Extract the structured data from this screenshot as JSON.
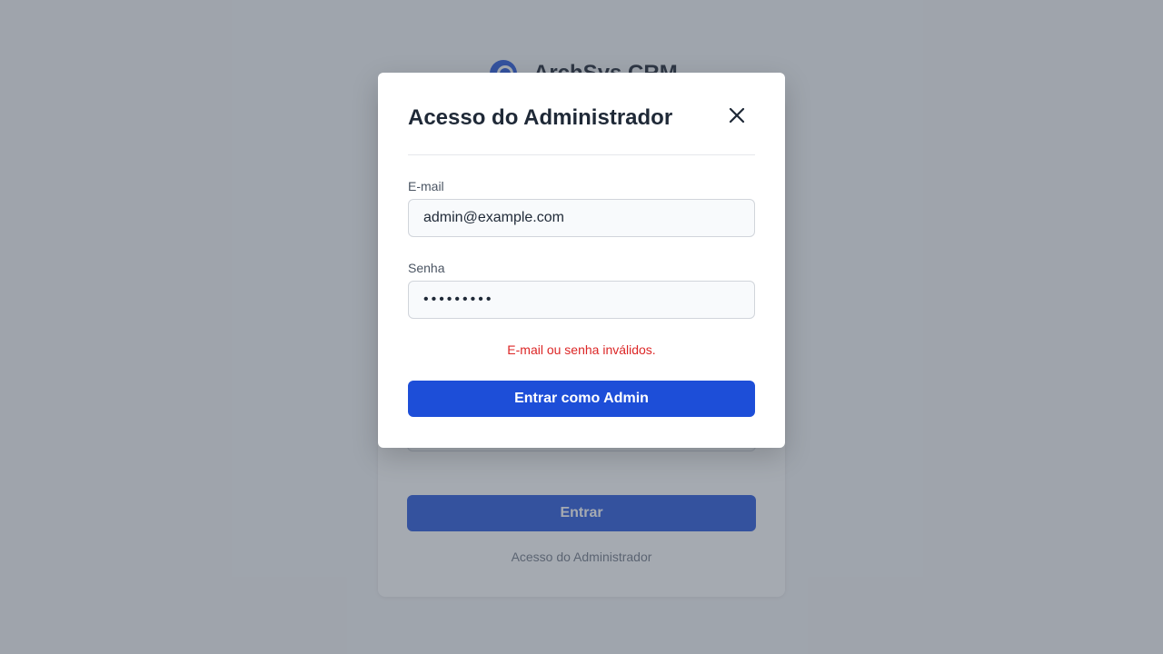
{
  "background": {
    "brand_name": "ArchSys CRM",
    "login_button_label": "Entrar",
    "admin_link_label": "Acesso do Administrador"
  },
  "modal": {
    "title": "Acesso do Administrador",
    "email_label": "E-mail",
    "email_value": "admin@example.com",
    "password_label": "Senha",
    "password_value": "•••••••••",
    "error_message": "E-mail ou senha inválidos.",
    "submit_label": "Entrar como Admin"
  },
  "icons": {
    "close": "close-icon",
    "logo": "logo-icon"
  },
  "colors": {
    "primary": "#1d4ed8",
    "error": "#dc2626",
    "overlay": "#4b5563",
    "title": "#1f2937"
  }
}
